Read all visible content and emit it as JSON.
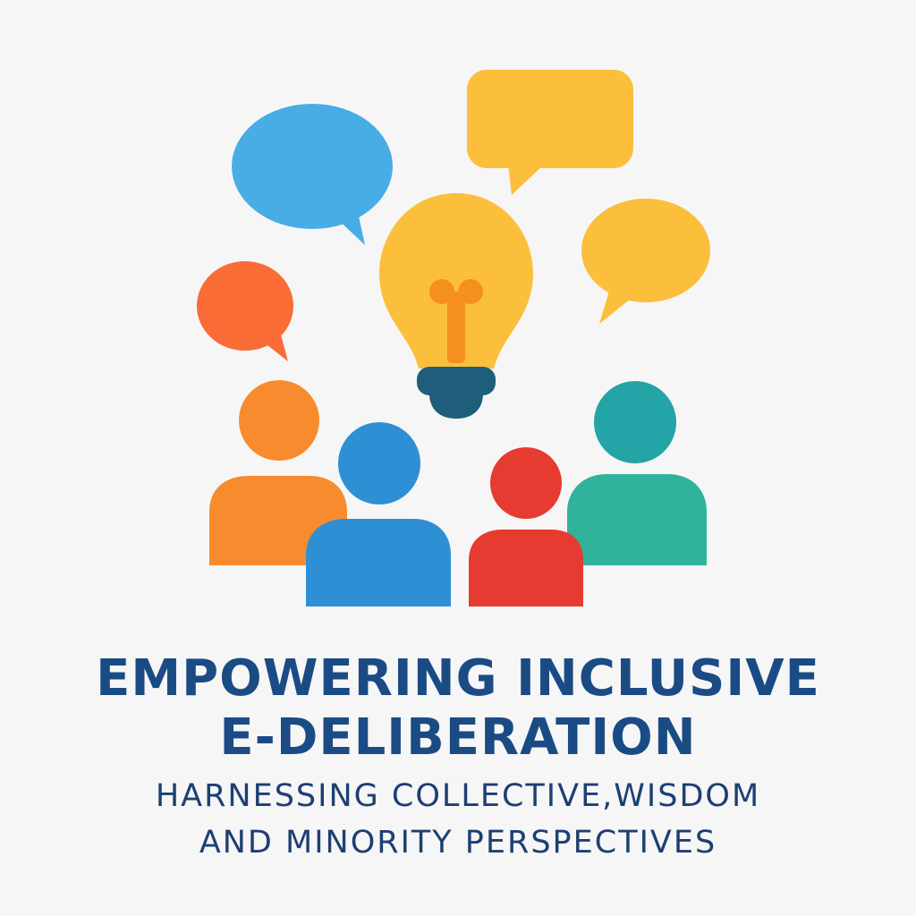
{
  "colors": {
    "background": "#f6f6f6",
    "title_text": "#1b4b84",
    "subtitle_text": "#1d3f73",
    "bubble_blue": "#47ade4",
    "bubble_yellow": "#fbbf3c",
    "bubble_orange": "#fa6c36",
    "bulb_yellow": "#fcbf3c",
    "bulb_filament": "#f5901f",
    "bulb_base": "#1e5e7a",
    "person_orange": "#f88b2e",
    "person_blue": "#2e8fd4",
    "person_red": "#e63b30",
    "person_teal_head": "#24a4a6",
    "person_teal_body": "#30b39b"
  },
  "icons": {
    "speech_bubbles": [
      "speech-bubble-blue-icon",
      "speech-bubble-yellow-rect-icon",
      "speech-bubble-yellow-oval-icon",
      "speech-bubble-orange-icon"
    ],
    "idea": "lightbulb-icon",
    "people": [
      "person-orange-icon",
      "person-blue-icon",
      "person-red-icon",
      "person-teal-icon"
    ]
  },
  "title": {
    "line1": "EMPOWERING INCLUSIVE",
    "line2": "E-DELIBERATION"
  },
  "subtitle": {
    "line1": "HARNESSING COLLECTIVE,WISDOM",
    "line2": "AND MINORITY PERSPECTIVES"
  }
}
